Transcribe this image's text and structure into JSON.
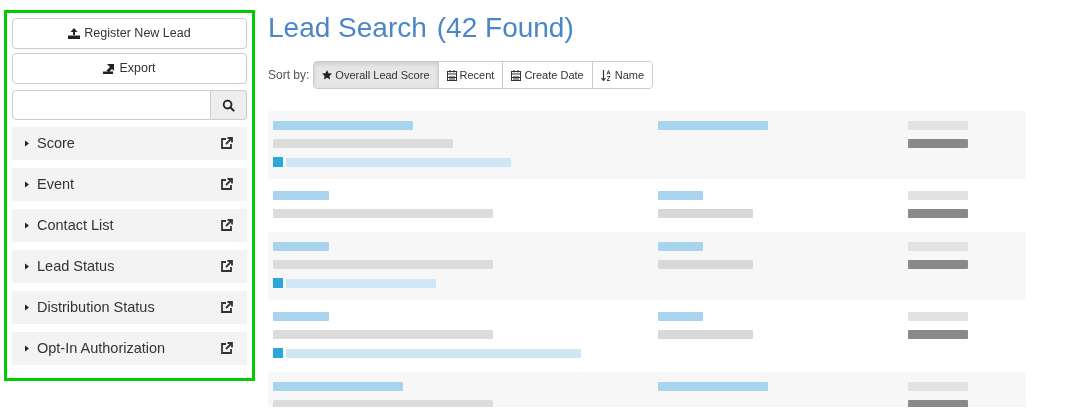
{
  "sidebar": {
    "actions": [
      {
        "label": "Register New Lead",
        "kind": "upload"
      },
      {
        "label": "Export",
        "kind": "export"
      }
    ],
    "filters": [
      {
        "label": "Score",
        "expanded": false
      },
      {
        "label": "Event",
        "expanded": false
      },
      {
        "label": "Contact List",
        "expanded": false
      },
      {
        "label": "Lead Status",
        "expanded": false
      },
      {
        "label": "Distribution Status",
        "expanded": false
      },
      {
        "label": "Opt-In Authorization",
        "expanded": false
      }
    ]
  },
  "header": {
    "title": "Lead Search",
    "count": "(42 Found)"
  },
  "sort": {
    "label": "Sort by:",
    "options": [
      {
        "label": "Overall Lead Score",
        "kind": "star",
        "selected": true
      },
      {
        "label": "Recent",
        "kind": "calendar",
        "selected": false
      },
      {
        "label": "Create Date",
        "kind": "calendar",
        "selected": false
      },
      {
        "label": "Name",
        "kind": "alpha",
        "selected": false
      }
    ]
  },
  "results": [
    {
      "phone": false,
      "tagged": true
    },
    {
      "phone": true,
      "tagged": false
    },
    {
      "phone": true,
      "tagged": true
    },
    {
      "phone": true,
      "tagged": true
    },
    {
      "phone": false,
      "tagged": false
    }
  ]
}
